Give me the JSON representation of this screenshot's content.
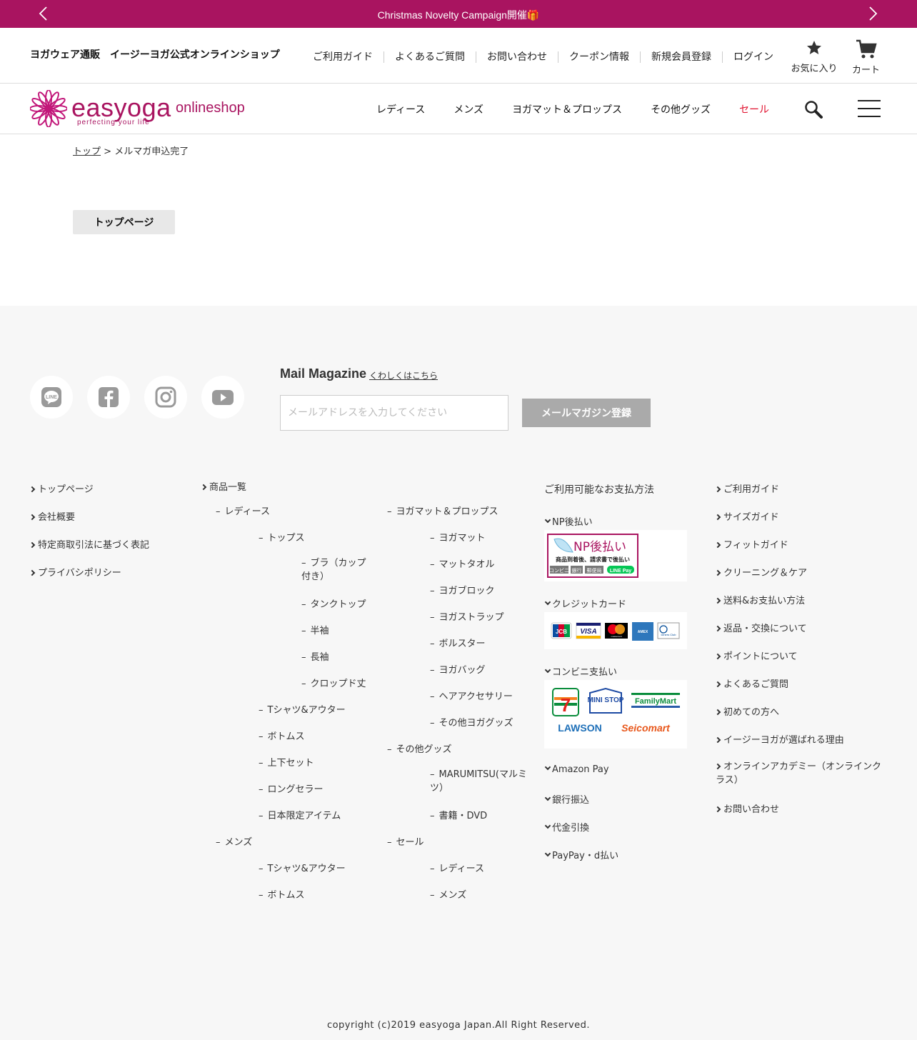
{
  "banner": {
    "text": "Christmas Novelty Campaign開催🎁"
  },
  "header": {
    "site_title": "ヨガウェア通販　イージーヨガ公式オンラインショップ",
    "util_nav": [
      "ご利用ガイド",
      "よくあるご質問",
      "お問い合わせ",
      "クーポン情報",
      "新規会員登録",
      "ログイン"
    ],
    "favorites_label": "お気に入り",
    "cart_label": "カート",
    "logo": {
      "word": "easyoga",
      "tagline": "perfecting your life",
      "shop": "onlineshop"
    },
    "main_nav": [
      "レディース",
      "メンズ",
      "ヨガマット＆プロップス",
      "その他グッズ",
      "セール"
    ],
    "sale_color": "#e0102d",
    "brand_color": "#a91460"
  },
  "breadcrumb": {
    "home": "トップ",
    "separator": ">",
    "current": "メルマガ申込完了"
  },
  "main": {
    "toppage_button": "トップページ"
  },
  "footer": {
    "social": [
      "line-icon",
      "facebook-icon",
      "instagram-icon",
      "youtube-icon"
    ],
    "mail_magazine": {
      "title": "Mail Magazine",
      "link": "くわしくはこちら",
      "placeholder": "メールアドレスを入力してください",
      "button": "メールマガジン登録"
    },
    "col1": [
      "トップページ",
      "会社概要",
      "特定商取引法に基づく表記",
      "プライバシポリシー"
    ],
    "products_title": "商品一覧",
    "ladies": {
      "label": "レディース",
      "tops": "トップス",
      "tops_children": [
        "ブラ（カップ付き）",
        "タンクトップ",
        "半袖",
        "長袖",
        "クロップド丈"
      ],
      "others": [
        "Tシャツ&アウター",
        "ボトムス",
        "上下セット",
        "ロングセラー",
        "日本限定アイテム"
      ]
    },
    "mens": {
      "label": "メンズ",
      "children": [
        "Tシャツ&アウター",
        "ボトムス"
      ]
    },
    "mats": {
      "label": "ヨガマット＆プロップス",
      "children": [
        "ヨガマット",
        "マットタオル",
        "ヨガブロック",
        "ヨガストラップ",
        "ボルスター",
        "ヨガバッグ",
        "ヘアアクセサリー",
        "その他ヨガグッズ"
      ]
    },
    "goods": {
      "label": "その他グッズ",
      "children": [
        "MARUMITSU(マルミツ）",
        "書籍・DVD"
      ]
    },
    "sale": {
      "label": "セール",
      "children": [
        "レディース",
        "メンズ"
      ]
    },
    "payment": {
      "title": "ご利用可能なお支払方法",
      "np": "NP後払い",
      "np_logo": {
        "main": "NP後払い",
        "sub": "商品到着後、請求書で後払い",
        "tags": [
          "コンビニ",
          "銀行",
          "郵便局",
          "LINE Pay"
        ]
      },
      "credit": "クレジットカード",
      "credit_cards": [
        "JCB",
        "VISA",
        "mastercard",
        "AMEX",
        "Diners Club"
      ],
      "conveni": "コンビニ支払い",
      "stores": [
        "7",
        "MINI STOP",
        "FamilyMart",
        "LAWSON",
        "Seicomart"
      ],
      "others": [
        "Amazon Pay",
        "銀行振込",
        "代金引換",
        "PayPay・d払い"
      ]
    },
    "col5": [
      "ご利用ガイド",
      "サイズガイド",
      "フィットガイド",
      "クリーニング＆ケア",
      "送料&お支払い方法",
      "返品・交換について",
      "ポイントについて",
      "よくあるご質問",
      "初めての方へ",
      "イージーヨガが選ばれる理由",
      "オンラインアカデミー（オンラインクラス）",
      "お問い合わせ"
    ],
    "copyright": "copyright (c)2019 easyoga Japan.All Right Reserved."
  }
}
